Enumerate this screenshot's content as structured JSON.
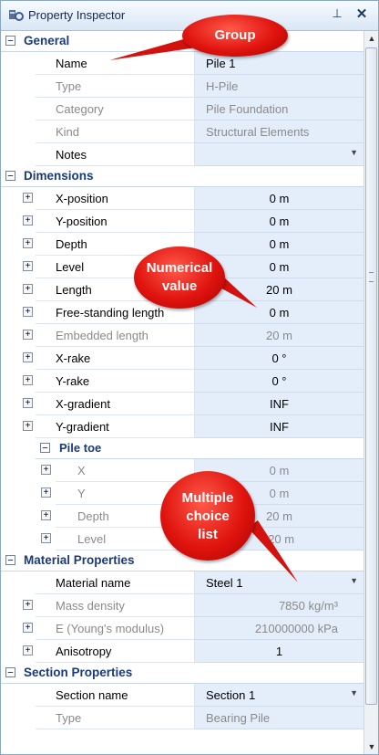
{
  "window": {
    "title": "Property Inspector",
    "pin_glyph": "⊥",
    "close_glyph": "✕"
  },
  "groups": {
    "general": {
      "label": "General",
      "rows": [
        {
          "name": "Name",
          "value": "Pile 1"
        },
        {
          "name": "Type",
          "value": "H-Pile"
        },
        {
          "name": "Category",
          "value": "Pile Foundation"
        },
        {
          "name": "Kind",
          "value": "Structural Elements"
        },
        {
          "name": "Notes",
          "value": ""
        }
      ]
    },
    "dimensions": {
      "label": "Dimensions",
      "rows": [
        {
          "name": "X-position",
          "value": "0 m"
        },
        {
          "name": "Y-position",
          "value": "0 m"
        },
        {
          "name": "Depth",
          "value": "0 m"
        },
        {
          "name": "Level",
          "value": "0 m"
        },
        {
          "name": "Length",
          "value": "20 m"
        },
        {
          "name": "Free-standing length",
          "value": "0 m"
        },
        {
          "name": "Embedded length",
          "value": "20 m"
        },
        {
          "name": "X-rake",
          "value": "0 °"
        },
        {
          "name": "Y-rake",
          "value": "0 °"
        },
        {
          "name": "X-gradient",
          "value": "INF"
        },
        {
          "name": "Y-gradient",
          "value": "INF"
        }
      ],
      "pile_toe": {
        "label": "Pile toe",
        "rows": [
          {
            "name": "X",
            "value": "0 m"
          },
          {
            "name": "Y",
            "value": "0 m"
          },
          {
            "name": "Depth",
            "value": "20 m"
          },
          {
            "name": "Level",
            "value": "-20 m"
          }
        ]
      }
    },
    "material": {
      "label": "Material Properties",
      "rows": [
        {
          "name": "Material name",
          "value": "Steel 1"
        },
        {
          "name": "Mass density",
          "value": "7850 kg/m³"
        },
        {
          "name": "E (Young's modulus)",
          "value": "210000000 kPa"
        },
        {
          "name": "Anisotropy",
          "value": "1"
        }
      ]
    },
    "section": {
      "label": "Section Properties",
      "rows": [
        {
          "name": "Section name",
          "value": "Section 1"
        },
        {
          "name": "Type",
          "value": "Bearing Pile"
        }
      ]
    }
  },
  "callouts": {
    "group": "Group",
    "numerical_line1": "Numerical",
    "numerical_line2": "value",
    "multiple_line1": "Multiple",
    "multiple_line2": "choice",
    "multiple_line3": "list"
  },
  "colors": {
    "group_header_text": "#1a3a7a",
    "value_background": "#e4eefb",
    "callout_red": "#e0140f"
  }
}
